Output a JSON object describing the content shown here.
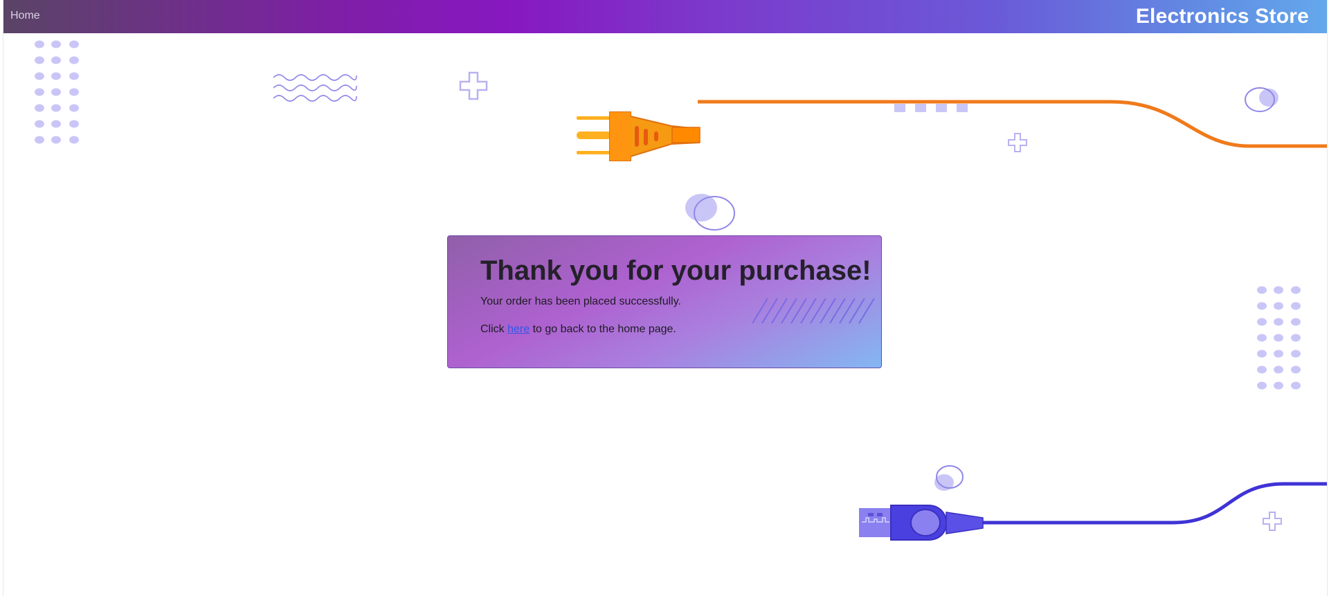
{
  "navbar": {
    "home_label": "Home",
    "brand_title": "Electronics Store"
  },
  "confirmation": {
    "heading": "Thank you for your purchase!",
    "message": "Your order has been placed successfully.",
    "back_prefix": "Click",
    "back_link_label": "here",
    "back_suffix": "to go back to the home page."
  },
  "colors": {
    "plug_orange": "#f07a1a",
    "usb_blue": "#3f33d6",
    "decor_lavender": "#c9c6f7",
    "link_blue": "#2f57e8"
  },
  "icons": {
    "power_plug": "power-plug-icon",
    "usb_plug": "usb-plug-icon"
  }
}
